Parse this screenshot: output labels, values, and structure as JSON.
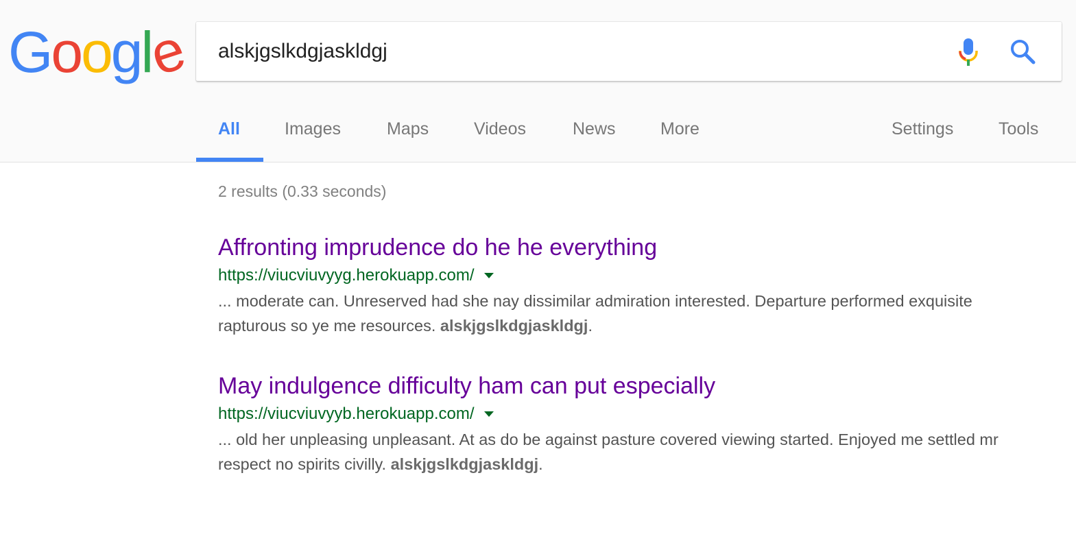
{
  "logo": {
    "letters": [
      "G",
      "o",
      "o",
      "g",
      "l",
      "e"
    ],
    "colors": [
      "#4285f4",
      "#ea4335",
      "#fbbc05",
      "#4285f4",
      "#34a853",
      "#ea4335"
    ]
  },
  "search": {
    "query": "alskjgslkdgjaskldgj",
    "mic_icon": "microphone-icon",
    "search_icon": "magnifier-icon"
  },
  "tabs": [
    {
      "label": "All",
      "active": true
    },
    {
      "label": "Images",
      "active": false
    },
    {
      "label": "Maps",
      "active": false
    },
    {
      "label": "Videos",
      "active": false
    },
    {
      "label": "News",
      "active": false
    },
    {
      "label": "More",
      "active": false
    }
  ],
  "tools": {
    "settings_label": "Settings",
    "tools_label": "Tools"
  },
  "stats": "2 results (0.33 seconds)",
  "results": [
    {
      "title": "Affronting imprudence do he he everything",
      "url": "https://viucviuvyyg.herokuapp.com/",
      "snippet_text": "... moderate can. Unreserved had she nay dissimilar admiration interested. Departure performed exquisite rapturous so ye me resources. ",
      "snippet_bold": "alskjgslkdgjaskldgj",
      "snippet_end": "."
    },
    {
      "title": "May indulgence difficulty ham can put especially",
      "url": "https://viucviuvyyb.herokuapp.com/",
      "snippet_text": "... old her unpleasing unpleasant. At as do be against pasture covered viewing started. Enjoyed me settled mr respect no spirits civilly. ",
      "snippet_bold": "alskjgslkdgjaskldgj",
      "snippet_end": "."
    }
  ],
  "colors": {
    "accent": "#4285f4",
    "visited_link": "#660099",
    "url_green": "#006621",
    "snippet_gray": "#545454"
  }
}
